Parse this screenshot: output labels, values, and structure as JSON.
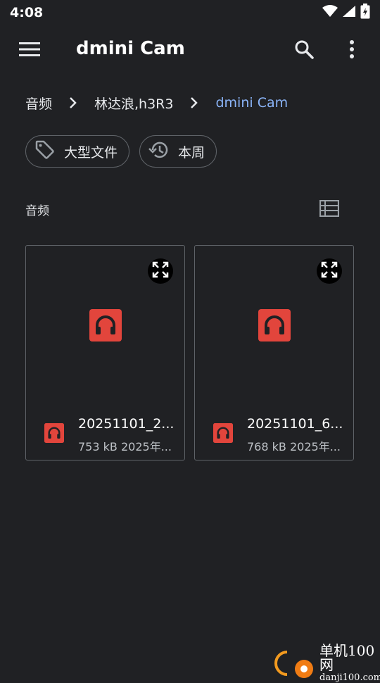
{
  "status_bar": {
    "time": "4:08",
    "icons": [
      "wifi-icon",
      "signal-icon",
      "battery-icon"
    ]
  },
  "app_bar": {
    "title": "dmini Cam",
    "icons": [
      "menu-icon",
      "search-icon",
      "more-vert-icon"
    ]
  },
  "breadcrumb": [
    {
      "label": "音频"
    },
    {
      "label": "林达浪,h3R3"
    },
    {
      "label": "dmini Cam"
    }
  ],
  "chips": [
    {
      "label": "大型文件",
      "icon": "tag-icon"
    },
    {
      "label": "本周",
      "icon": "history-icon"
    }
  ],
  "section": {
    "title": "音频",
    "view_icon": "list-view-icon"
  },
  "files": [
    {
      "name": "20251101_2...",
      "size": "753 kB",
      "date": "2025年...",
      "icon": "headphones-icon"
    },
    {
      "name": "20251101_6...",
      "size": "768 kB",
      "date": "2025年...",
      "icon": "headphones-icon"
    }
  ],
  "watermark": {
    "cn": "单机100网",
    "en": "danji100.com"
  },
  "colors": {
    "background": "#202124",
    "accent": "#8ab4f8",
    "audio_icon": "#e2453c",
    "border": "#5f6368"
  }
}
